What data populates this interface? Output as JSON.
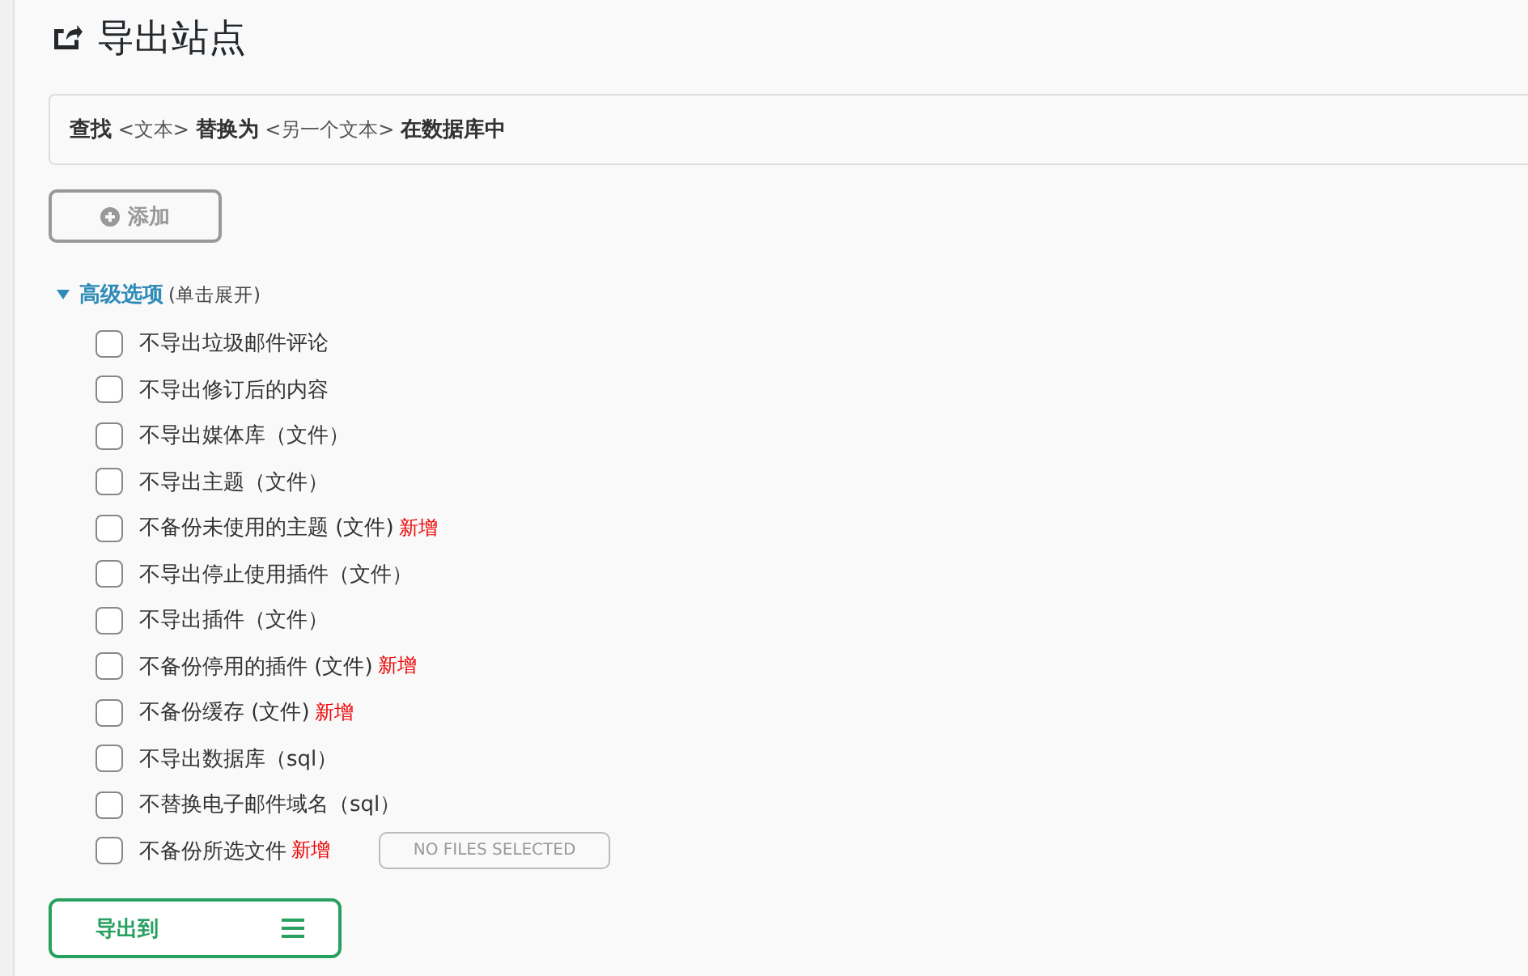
{
  "title": "导出站点",
  "find_replace": "**查找** <文本> **替换为** <另一个文本> **在数据库中**",
  "add_button": {
    "label": "添加",
    "disabled": true
  },
  "advanced": {
    "label": "高级选项",
    "hint": "(单击展开)",
    "expanded": true
  },
  "options": [
    {
      "label": "不导出垃圾邮件评论",
      "checked": false
    },
    {
      "label": "不导出修订后的内容",
      "checked": false
    },
    {
      "label": "不导出媒体库（文件）",
      "checked": false
    },
    {
      "label": "不导出主题（文件）",
      "checked": false
    },
    {
      "label": "不备份未使用的主题 (文件)",
      "checked": false,
      "badge": "新增"
    },
    {
      "label": "不导出停止使用插件（文件）",
      "checked": false
    },
    {
      "label": "不导出插件（文件）",
      "checked": false
    },
    {
      "label": "不备份停用的插件 (文件)",
      "checked": false,
      "badge": "新增"
    },
    {
      "label": "不备份缓存 (文件)",
      "checked": false,
      "badge": "新增"
    },
    {
      "label": "不导出数据库（sql）",
      "checked": false
    },
    {
      "label": "不替换电子邮件域名（sql）",
      "checked": false
    },
    {
      "label": "不备份所选文件",
      "checked": false,
      "badge": "新增",
      "file_button": "NO FILES SELECTED"
    }
  ],
  "export_button": "导出到"
}
